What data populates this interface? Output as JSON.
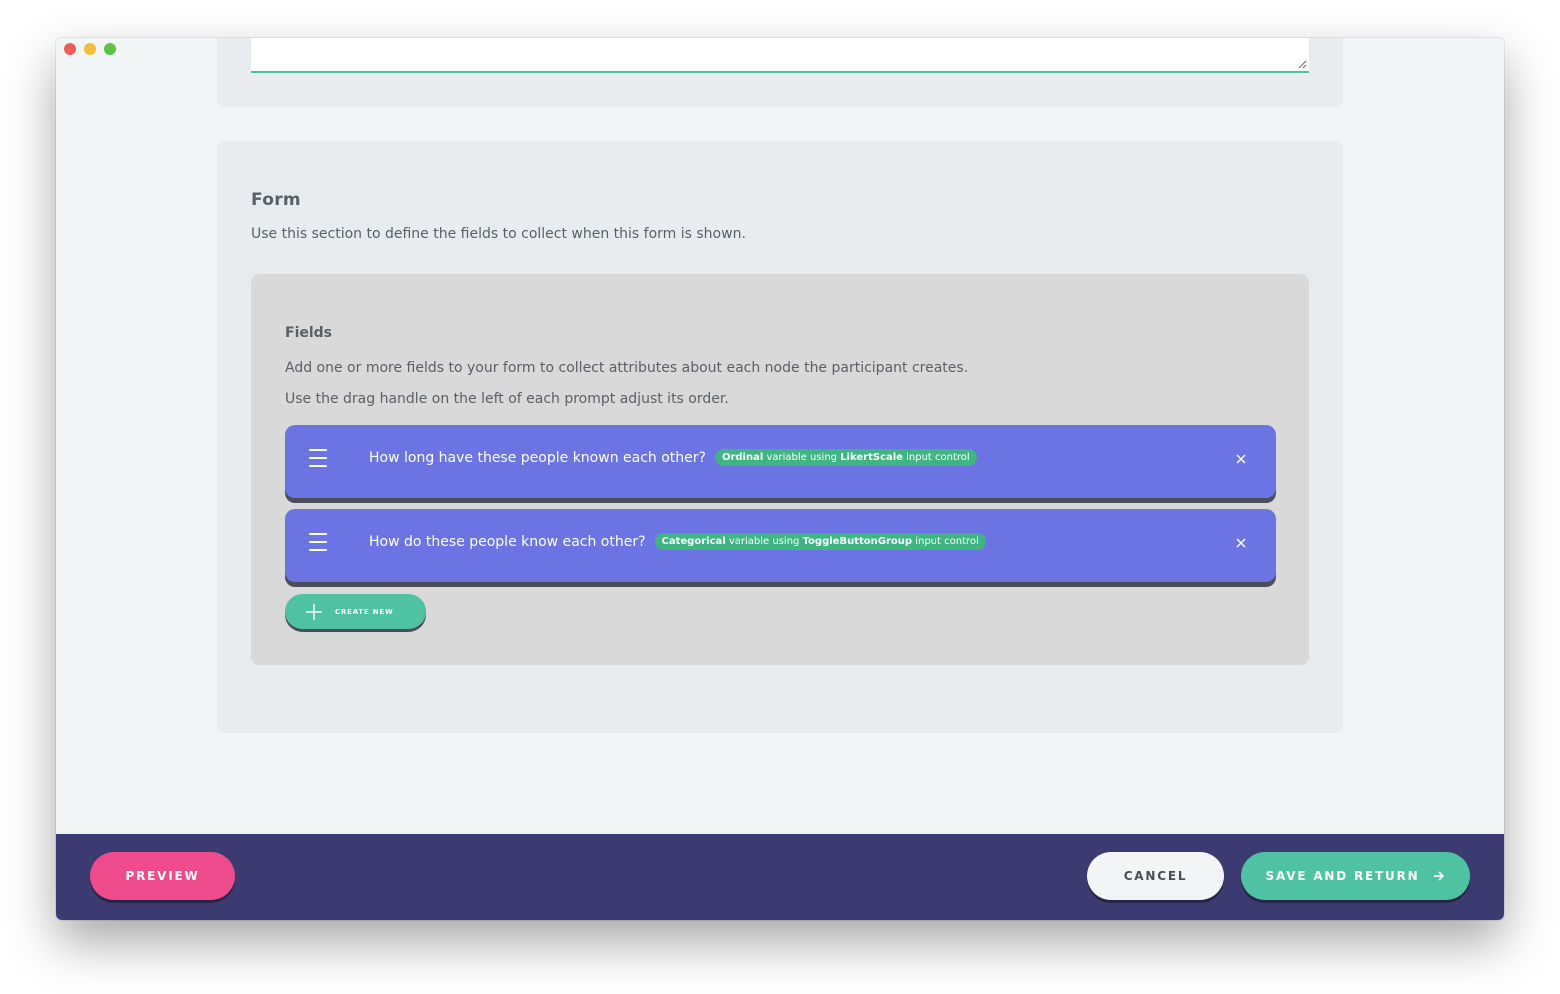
{
  "form": {
    "title": "Form",
    "description": "Use this section to define the fields to collect when this form is shown."
  },
  "fields": {
    "title": "Fields",
    "description_1": "Add one or more fields to your form to collect attributes about each node the participant creates.",
    "description_2": "Use the drag handle on the left of each prompt adjust its order.",
    "items": [
      {
        "label": "How long have these people known each other?",
        "var_type": "Ordinal",
        "text_a": " variable using ",
        "control": "LikertScale",
        "text_b": " input control"
      },
      {
        "label": "How do these people know each other?",
        "var_type": "Categorical",
        "text_a": " variable using ",
        "control": "ToggleButtonGroup",
        "text_b": " input control"
      }
    ],
    "create_label": "CREATE NEW"
  },
  "footer": {
    "preview_label": "PREVIEW",
    "cancel_label": "CANCEL",
    "save_label": "SAVE AND RETURN"
  },
  "colors": {
    "accent_green": "#4fc3a1",
    "prompt_purple": "#6c74e4",
    "footer_navy": "#3b3a71",
    "preview_pink": "#ee4b8c"
  },
  "icons": {
    "drag": "drag-handle-icon",
    "close": "close-icon",
    "plus": "plus-icon",
    "arrow": "arrow-right-icon"
  }
}
